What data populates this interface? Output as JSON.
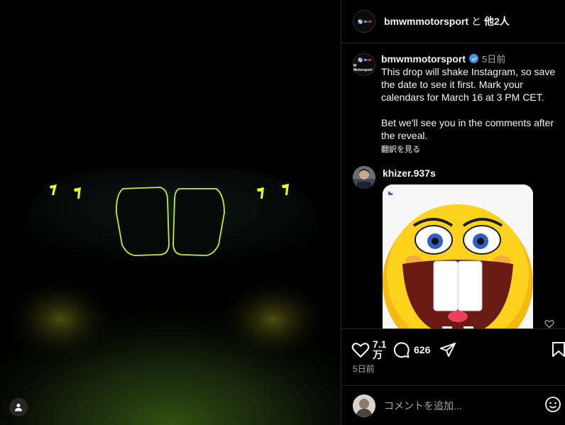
{
  "post": {
    "header": {
      "username": "bmwmmotorsport",
      "connector": "と",
      "others": "他2人"
    },
    "avatar_logo_text": "M Motorsport",
    "caption": {
      "username": "bmwmmotorsport",
      "time": "5日前",
      "text": "This drop will shake Instagram, so save the date to see it first. Mark your calendars for March 16 at 3 PM CET.\n\nBet we'll see you in the comments after the reveal.",
      "translate_label": "翻訳を見る"
    },
    "comment": {
      "username": "khizer.937s",
      "gif": "laughing-emoji-gif"
    },
    "actions": {
      "likes": "7.1\n万",
      "comments": "626"
    },
    "post_time": "5日前",
    "comment_box": {
      "placeholder": "コメントを追加..."
    }
  },
  "colors": {
    "grille_glow": "#c8f025",
    "verified": "#3b97f0",
    "muted_text": "#a8a8a8"
  },
  "icons": [
    "user-tag-icon",
    "verified-icon",
    "heart-icon",
    "comment-icon",
    "share-icon",
    "bookmark-icon",
    "emoji-icon"
  ]
}
